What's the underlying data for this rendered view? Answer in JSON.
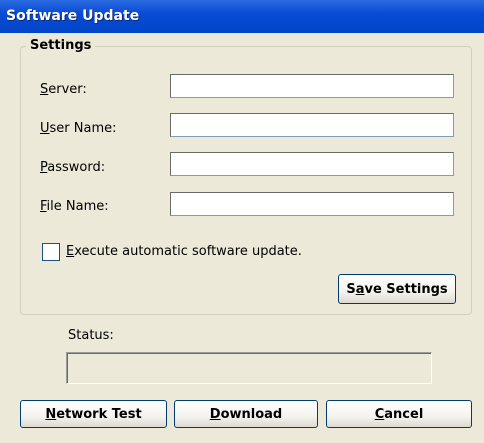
{
  "window": {
    "title": "Software Update"
  },
  "settings": {
    "group_label": "Settings",
    "fields": [
      {
        "key": "S",
        "label_rest": "erver:",
        "value": ""
      },
      {
        "key": "U",
        "label_rest": "ser Name:",
        "value": ""
      },
      {
        "key": "P",
        "label_rest": "assword:",
        "value": ""
      },
      {
        "key": "F",
        "label_rest": "ile Name:",
        "value": ""
      }
    ],
    "checkbox": {
      "key": "E",
      "label_rest": "xecute automatic software update.",
      "checked": false
    },
    "save_button": {
      "pre": "S",
      "key": "a",
      "post": "ve Settings"
    }
  },
  "status": {
    "label": "Status:",
    "value": ""
  },
  "buttons": {
    "network_test": {
      "key": "N",
      "rest": "etwork Test"
    },
    "download": {
      "key": "D",
      "rest": "ownload"
    },
    "cancel": {
      "key": "C",
      "rest": "ancel"
    }
  },
  "colors": {
    "titlebar": "#0a4bd6",
    "window_bg": "#ece9d8",
    "button_border": "#003c74"
  }
}
